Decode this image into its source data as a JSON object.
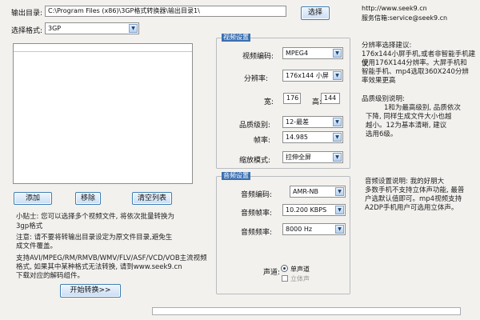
{
  "top": {
    "output_dir_label": "输出目录:",
    "output_dir_value": "C:\\Program Files (x86)\\3GP格式转换器\\输出目录1\\",
    "browse_button": "选择",
    "website": "http://www.seek9.cn",
    "email": "服务信箱:service@seek9.cn",
    "format_label": "选择格式:",
    "format_value": "3GP"
  },
  "buttons": {
    "add": "添加",
    "remove": "移除",
    "clear": "清空列表",
    "start": "开始转换>>"
  },
  "tips": {
    "line1": "小贴士: 您可以选择多个视频文件, 将依次批量转换为",
    "line2": "3gp格式",
    "line3": "注意: 请不要将转输出目录设定为原文件目录,避免生",
    "line4": "成文件覆盖。",
    "line5": "支持AVI/MPEG/RM/RMVB/WMV/FLV/ASF/VCD/VOB主流视频",
    "line6": "格式, 如果其中某种格式无法转换, 请到www.seek9.cn",
    "line7": "下载对应的解码组件。"
  },
  "video": {
    "legend": "视频设置",
    "codec_label": "视频编码:",
    "codec_value": "MPEG4",
    "resolution_label": "分辨率:",
    "resolution_value": "176x144 小屏",
    "width_label": "宽:",
    "width_value": "176",
    "height_label": "高:",
    "height_value": "144",
    "quality_label": "品质级别:",
    "quality_value": "12-最差",
    "framerate_label": "帧率:",
    "framerate_value": "14.985",
    "zoom_label": "缩放模式:",
    "zoom_value": "拉伸全屏"
  },
  "audio": {
    "legend": "音频设置",
    "codec_label": "音频编码:",
    "codec_value": "AMR-NB",
    "bitrate_label": "音频帧率:",
    "bitrate_value": "10.200 KBPS",
    "samplerate_label": "音频频率:",
    "samplerate_value": "8000 Hz",
    "channel_label": "声道:",
    "mono_label": "单声道",
    "stereo_label": "立体声"
  },
  "right_notes": {
    "res_1": "分辨率选择建议:",
    "res_2": "176x144小屏手机,或者非智能手机建议",
    "res_3": "使用176X144分辨率。大屏手机和",
    "res_4": "智能手机、mp4选取360X240分辨",
    "res_5": "率效果更高",
    "q_1": "品质级别说明:",
    "q_2": "1和为最高级别, 品质依次",
    "q_3": "下降, 同样生成文件大小也越",
    "q_4": "越小。12为基本清晰, 建议",
    "q_5": "选用6级。",
    "a_1": "音频设置说明:     我的好朋大",
    "a_2": "多数手机不支持立体声功能, 最普",
    "a_3": "户选默认值即可。mp4视频支持",
    "a_4": "A2DP手机用户可选用立体声。"
  },
  "progress": {
    "value": 0
  }
}
